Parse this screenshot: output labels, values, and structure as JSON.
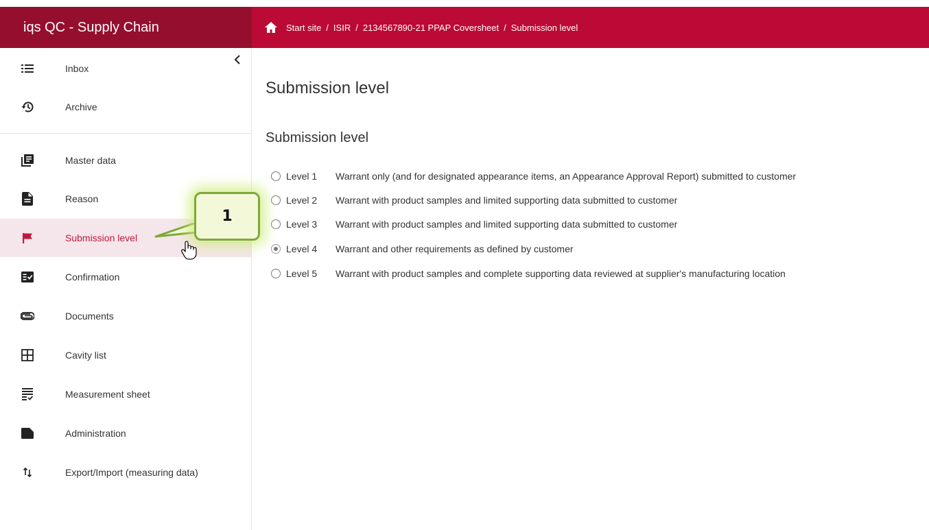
{
  "app": {
    "title": "iqs QC - Supply Chain"
  },
  "breadcrumb": [
    "Start site",
    "ISIR",
    "2134567890-21 PPAP Coversheet",
    "Submission level"
  ],
  "sidebar": {
    "items": [
      {
        "label": "Inbox",
        "icon": "list-icon"
      },
      {
        "label": "Archive",
        "icon": "history-icon"
      },
      {
        "label": "Master data",
        "icon": "library-books-icon"
      },
      {
        "label": "Reason",
        "icon": "description-icon"
      },
      {
        "label": "Submission level",
        "icon": "flag-icon",
        "active": true
      },
      {
        "label": "Confirmation",
        "icon": "fact-check-icon"
      },
      {
        "label": "Documents",
        "icon": "attachment-icon"
      },
      {
        "label": "Cavity list",
        "icon": "grid-icon"
      },
      {
        "label": "Measurement sheet",
        "icon": "checklist-icon"
      },
      {
        "label": "Administration",
        "icon": "folder-icon"
      },
      {
        "label": "Export/Import (measuring data)",
        "icon": "import-export-icon"
      }
    ]
  },
  "main": {
    "page_title": "Submission level",
    "section_title": "Submission level",
    "options": [
      {
        "level": "Level 1",
        "text": "Warrant only (and for designated appearance items, an Appearance Approval Report) submitted to customer",
        "selected": false
      },
      {
        "level": "Level 2",
        "text": "Warrant with product samples and limited supporting data submitted to customer",
        "selected": false
      },
      {
        "level": "Level 3",
        "text": "Warrant with product samples and limited supporting data submitted to customer",
        "selected": false
      },
      {
        "level": "Level 4",
        "text": "Warrant and other requirements as defined by customer",
        "selected": true
      },
      {
        "level": "Level 5",
        "text": "Warrant with product samples and complete supporting data reviewed at supplier's manufacturing location",
        "selected": false
      }
    ]
  },
  "callout": {
    "number": "1"
  },
  "colors": {
    "brand": "#950e2e",
    "header": "#bb0a35",
    "active_text": "#c4173f",
    "active_bg": "#f4e6ea",
    "callout_border": "#7ea83b"
  }
}
